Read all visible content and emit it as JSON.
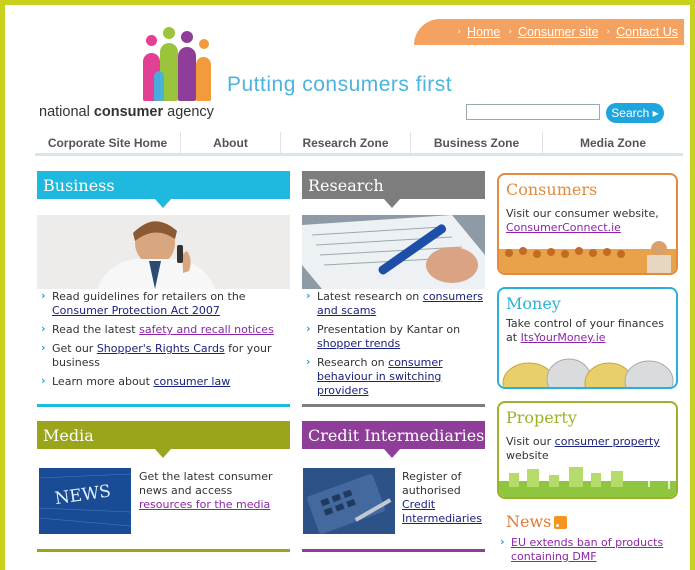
{
  "toplinks": [
    "Home",
    "Consumer site",
    "Contact Us"
  ],
  "brand": {
    "tagline": "Putting consumers first",
    "name_prefix": "national ",
    "name_bold": "consumer",
    "name_suffix": " agency"
  },
  "search": {
    "button": "Search ▸",
    "placeholder": ""
  },
  "nav": [
    "Corporate Site Home",
    "About",
    "Research Zone",
    "Business Zone",
    "Media Zone"
  ],
  "business": {
    "title": "Business",
    "items": [
      {
        "pre": "Read guidelines for retailers on the ",
        "link": "Consumer Protection Act 2007",
        "post": ""
      },
      {
        "pre": "Read the latest ",
        "link": "safety and recall notices",
        "post": ""
      },
      {
        "pre": "Get our ",
        "link": "Shopper's Rights Cards",
        "post": " for your business"
      },
      {
        "pre": "Learn more about ",
        "link": "consumer law",
        "post": ""
      }
    ]
  },
  "research": {
    "title": "Research",
    "items": [
      {
        "pre": "Latest research on ",
        "link": "consumers and scams",
        "post": ""
      },
      {
        "pre": "Presentation by Kantar on ",
        "link": "shopper trends",
        "post": ""
      },
      {
        "pre": "Research on ",
        "link": "consumer behaviour in switching providers",
        "post": ""
      }
    ]
  },
  "media": {
    "title": "Media",
    "text": "Get the latest consumer news and access ",
    "link": "resources for the media",
    "image_word": "NEWS"
  },
  "credit": {
    "title": "Credit Intermediaries",
    "text": "Register of authorised ",
    "link": "Credit Intermediaries"
  },
  "consumers": {
    "title": "Consumers",
    "text": "Visit our consumer website, ",
    "link": "ConsumerConnect.ie"
  },
  "money": {
    "title": "Money",
    "text": "Take control of your finances at ",
    "link": "ItsYourMoney.ie"
  },
  "property": {
    "title": "Property",
    "pre": "Visit our ",
    "link": "consumer property",
    "post": " website"
  },
  "news": {
    "title": "News",
    "items": [
      "EU extends ban of products containing DMF"
    ]
  },
  "colors": {
    "frame": "#c8d21e",
    "business": "#1fb8de",
    "research": "#7d7d7d",
    "media": "#9aa51c",
    "credit": "#8e3d98",
    "consumers": "#e38a3e",
    "money": "#2ab1d9",
    "property": "#9bb22a"
  }
}
